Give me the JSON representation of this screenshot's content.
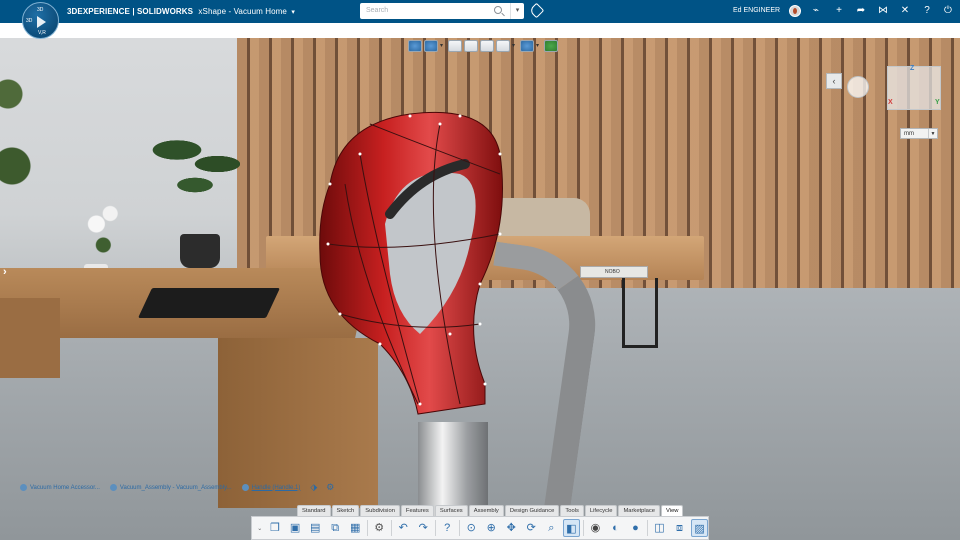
{
  "topbar": {
    "brand_main": "3DEXPERIENCE | SOLIDWORKS",
    "brand_app": "xShape - Vacuum Home",
    "search_placeholder": "Search",
    "user_name": "Ed ENGINEER",
    "icons": [
      "tag-icon",
      "share-icon",
      "add-icon",
      "forward-icon",
      "network-icon",
      "tools-icon",
      "help-icon",
      "power-icon"
    ]
  },
  "compass": {
    "top": "3D",
    "left": "3D",
    "bottom": "V,R"
  },
  "viewport": {
    "units": "mm",
    "axes": {
      "x": "X",
      "y": "Y",
      "z": "Z"
    },
    "book_text": "NOBO"
  },
  "breadcrumb": {
    "items": [
      "Vacuum Home Accessor...",
      "Vacuum_Assembly - Vacuum_Assembly...",
      "Handle (Handle.1)"
    ]
  },
  "action_bar": {
    "tabs": [
      "Standard",
      "Sketch",
      "Subdivision",
      "Features",
      "Surfaces",
      "Assembly",
      "Design Guidance",
      "Tools",
      "Lifecycle",
      "Marketplace",
      "View"
    ],
    "active_tab": "View",
    "tools": [
      "new-icon",
      "open-icon",
      "save-icon",
      "save-all-icon",
      "properties-icon",
      "settings-icon",
      "undo-icon",
      "redo-icon",
      "help-icon",
      "fit-all-icon",
      "zoom-icon",
      "pan-icon",
      "rotate-icon",
      "zoom-area-icon",
      "cube-view-icon",
      "hide-show-icon",
      "material-icon",
      "render-icon",
      "section-icon",
      "capture-icon",
      "image-icon"
    ]
  },
  "colors": {
    "topbar": "#005386",
    "handle_red": "#b61a1a",
    "accent": "#2f6eaa"
  }
}
